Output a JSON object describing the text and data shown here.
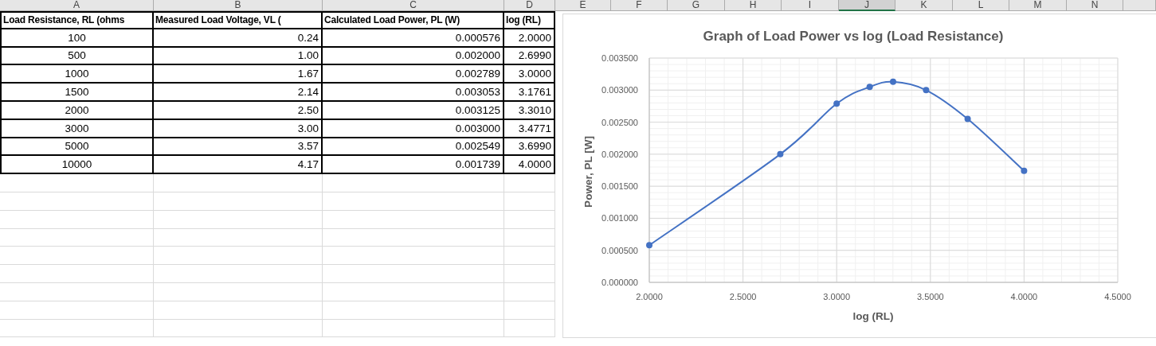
{
  "sheet": {
    "columns": [
      {
        "label": "A",
        "selected": false
      },
      {
        "label": "B",
        "selected": false
      },
      {
        "label": "C",
        "selected": false
      },
      {
        "label": "D",
        "selected": false
      },
      {
        "label": "E",
        "selected": false
      },
      {
        "label": "F",
        "selected": false
      },
      {
        "label": "G",
        "selected": false
      },
      {
        "label": "H",
        "selected": false
      },
      {
        "label": "I",
        "selected": false
      },
      {
        "label": "J",
        "selected": true
      },
      {
        "label": "K",
        "selected": false
      },
      {
        "label": "L",
        "selected": false
      },
      {
        "label": "M",
        "selected": false
      },
      {
        "label": "N",
        "selected": false
      }
    ]
  },
  "table": {
    "headers": [
      "Load Resistance, RL (ohms",
      "Measured Load Voltage, VL (",
      "Calculated Load Power, PL (W)",
      "log (RL)"
    ],
    "rows": [
      [
        "100",
        "0.24",
        "0.000576",
        "2.0000"
      ],
      [
        "500",
        "1.00",
        "0.002000",
        "2.6990"
      ],
      [
        "1000",
        "1.67",
        "0.002789",
        "3.0000"
      ],
      [
        "1500",
        "2.14",
        "0.003053",
        "3.1761"
      ],
      [
        "2000",
        "2.50",
        "0.003125",
        "3.3010"
      ],
      [
        "3000",
        "3.00",
        "0.003000",
        "3.4771"
      ],
      [
        "5000",
        "3.57",
        "0.002549",
        "3.6990"
      ],
      [
        "10000",
        "4.17",
        "0.001739",
        "4.0000"
      ]
    ]
  },
  "chart": {
    "chart_data": {
      "type": "line",
      "grid": true,
      "title": "Graph of Load Power vs log (Load Resistance)",
      "xlabel": "log (RL)",
      "ylabel": "Power, PL [W]",
      "x": [
        2.0,
        2.699,
        3.0,
        3.1761,
        3.301,
        3.4771,
        3.699,
        4.0
      ],
      "series": [
        {
          "color": "#4472c4",
          "marker": "circle",
          "values": [
            0.00058,
            0.002,
            0.00279,
            0.00305,
            0.00313,
            0.003,
            0.00255,
            0.00174
          ]
        }
      ],
      "xlim": [
        2,
        4.5
      ],
      "ylim": [
        0,
        0.0035
      ],
      "xticks": [
        {
          "value": 2,
          "label": "2.0000"
        },
        {
          "value": 2.5,
          "label": "2.5000"
        },
        {
          "value": 3,
          "label": "3.0000"
        },
        {
          "value": 3.5,
          "label": "3.5000"
        },
        {
          "value": 4,
          "label": "4.0000"
        },
        {
          "value": 4.5,
          "label": "4.5000"
        }
      ],
      "yticks": [
        {
          "value": 0,
          "label": "0.000000"
        },
        {
          "value": 0.0005,
          "label": "0.000500"
        },
        {
          "value": 0.001,
          "label": "0.001000"
        },
        {
          "value": 0.0015,
          "label": "0.001500"
        },
        {
          "value": 0.002,
          "label": "0.002000"
        },
        {
          "value": 0.0025,
          "label": "0.002500"
        },
        {
          "value": 0.003,
          "label": "0.003000"
        },
        {
          "value": 0.0035,
          "label": "0.003500"
        }
      ]
    }
  }
}
